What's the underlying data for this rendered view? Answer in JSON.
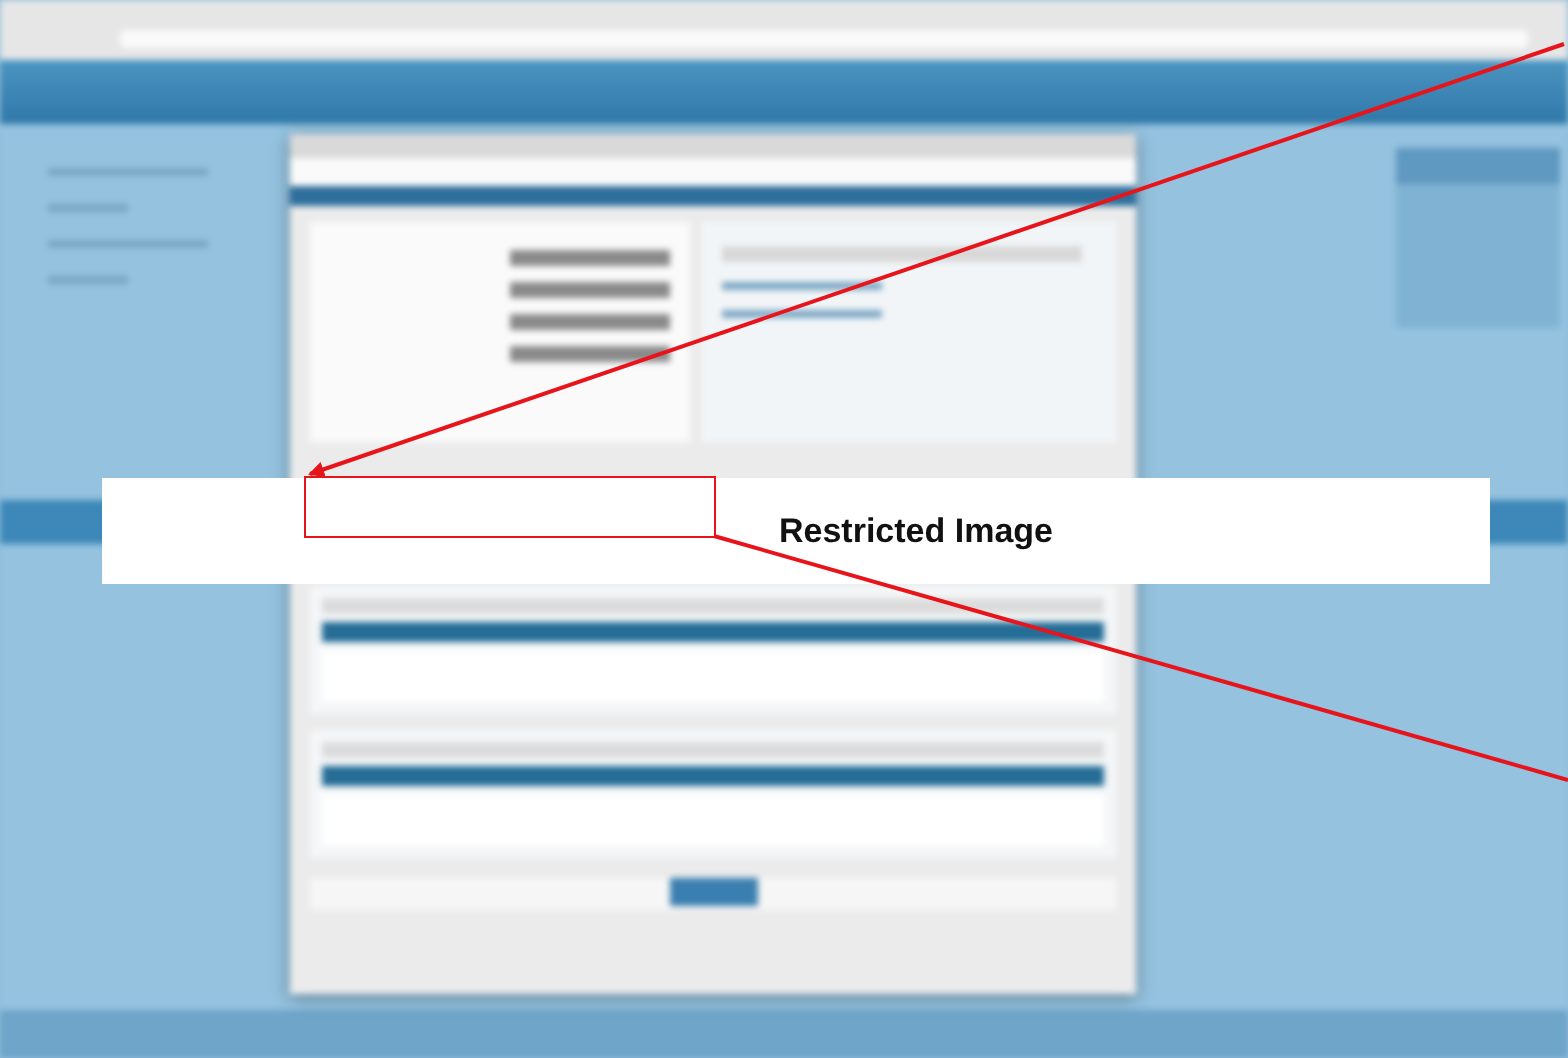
{
  "banner": {
    "text": "Restricted Image"
  }
}
